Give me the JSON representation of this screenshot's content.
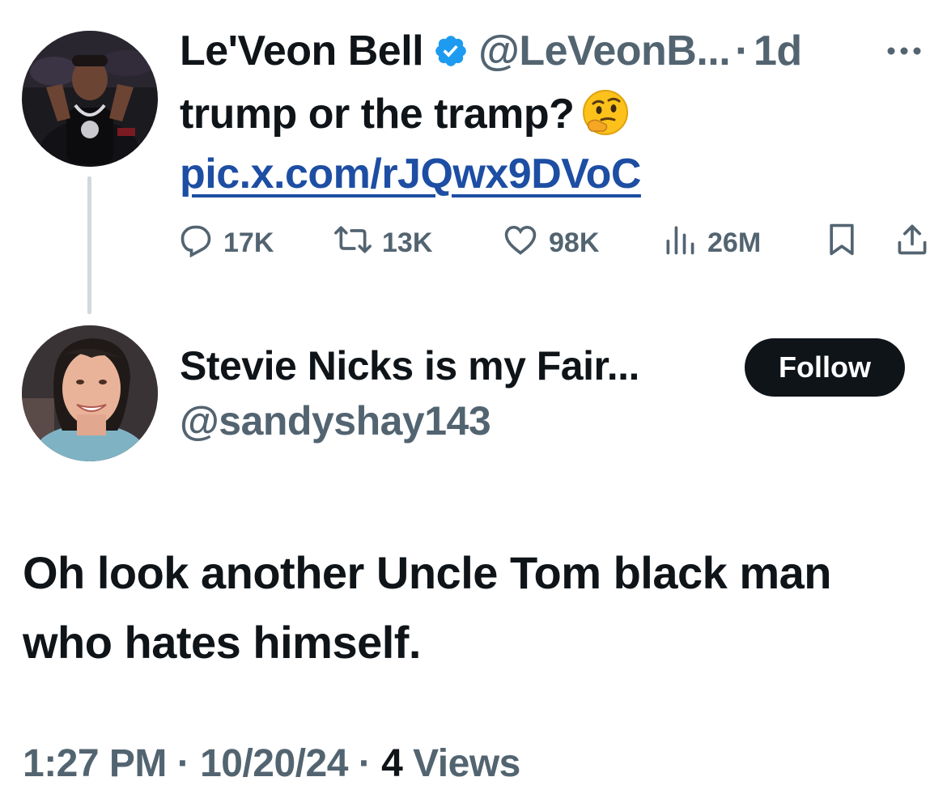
{
  "original_tweet": {
    "display_name": "Le'Veon Bell",
    "handle": "@LeVeonB...",
    "separator": "·",
    "time_ago": "1d",
    "text": "trump or the tramp?",
    "emoji": "🤔",
    "link": "pic.x.com/rJQwx9DVoC",
    "actions": {
      "replies": "17K",
      "reposts": "13K",
      "likes": "98K",
      "views": "26M"
    },
    "icons": [
      "verified-badge-icon",
      "more-icon",
      "reply-icon",
      "repost-icon",
      "like-icon",
      "views-icon",
      "bookmark-icon",
      "share-icon"
    ]
  },
  "reply_tweet": {
    "display_name": "Stevie Nicks is my Fair...",
    "handle": "@sandyshay143",
    "follow_label": "Follow",
    "text": "Oh look another Uncle Tom black man who hates himself.",
    "time": "1:27 PM",
    "sep1": "·",
    "date": "10/20/24",
    "sep2": "·",
    "views_count": "4",
    "views_label": "Views"
  },
  "colors": {
    "text_primary": "#0f1419",
    "text_secondary": "#536471",
    "link": "#1d4ea3",
    "verified": "#1d9bf0",
    "follow_bg": "#0f1419",
    "thread_line": "#cfd9de"
  }
}
